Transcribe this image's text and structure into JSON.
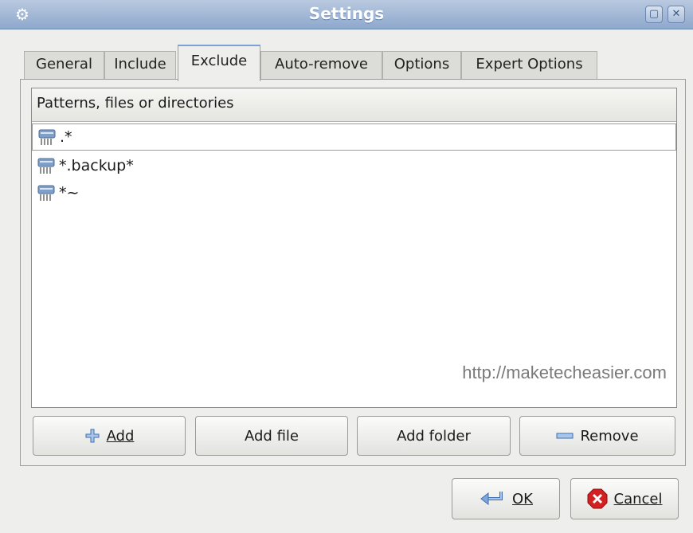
{
  "window": {
    "title": "Settings",
    "icon": "gear-icon",
    "controls": [
      "restore-icon",
      "close-icon"
    ]
  },
  "tabs": [
    {
      "label": "General",
      "active": false
    },
    {
      "label": "Include",
      "active": false
    },
    {
      "label": "Exclude",
      "active": true
    },
    {
      "label": "Auto-remove",
      "active": false
    },
    {
      "label": "Options",
      "active": false
    },
    {
      "label": "Expert Options",
      "active": false
    }
  ],
  "list": {
    "column_header": "Patterns, files or directories",
    "items": [
      {
        "icon": "shredder-icon",
        "text": ".*",
        "selected": true
      },
      {
        "icon": "shredder-icon",
        "text": "*.backup*",
        "selected": false
      },
      {
        "icon": "shredder-icon",
        "text": "*~",
        "selected": false
      }
    ],
    "watermark": "http://maketecheasier.com"
  },
  "actions": {
    "add": {
      "label": "Add",
      "icon": "plus-icon"
    },
    "add_file": {
      "label": "Add file"
    },
    "add_folder": {
      "label": "Add folder"
    },
    "remove": {
      "label": "Remove",
      "icon": "minus-icon"
    }
  },
  "dialog": {
    "ok": {
      "label": "OK",
      "icon": "return-arrow-icon"
    },
    "cancel": {
      "label": "Cancel",
      "icon": "cancel-icon"
    }
  },
  "colors": {
    "titlebar": "#9ab1d3",
    "tab_highlight": "#7aa0d4",
    "cancel_red": "#d32020"
  }
}
